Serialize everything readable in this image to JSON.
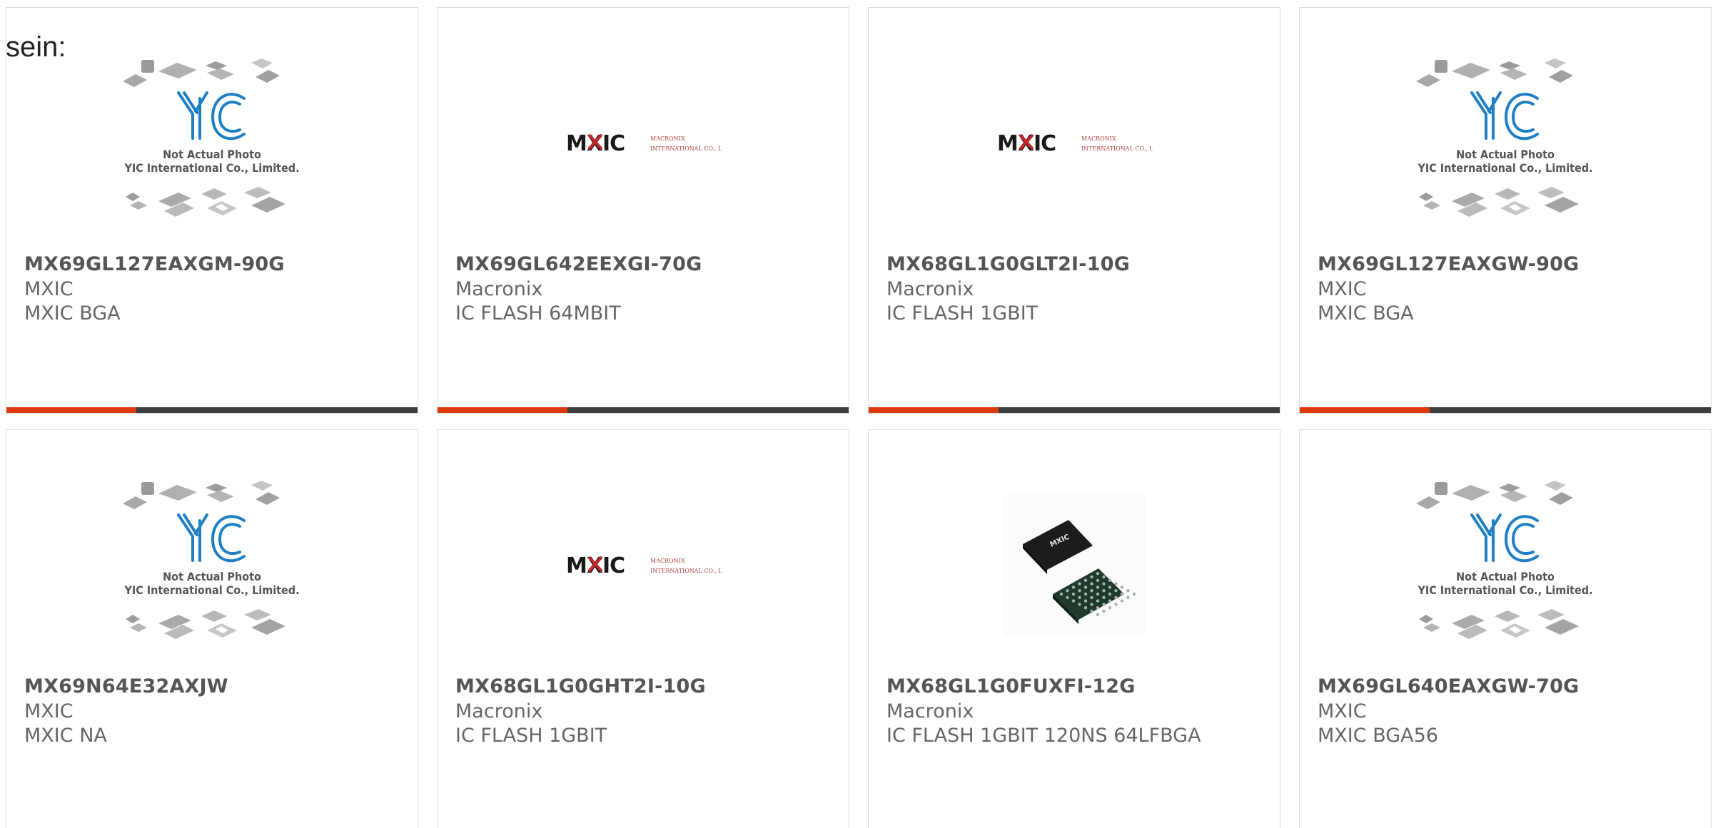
{
  "lead_text": "sein:",
  "products": [
    {
      "part": "MX69GL127EAXGM-90G",
      "manufacturer": "MXIC",
      "description": "MXIC BGA",
      "image": "yic-placeholder"
    },
    {
      "part": "MX69GL642EEXGI-70G",
      "manufacturer": "Macronix",
      "description": "IC FLASH 64MBIT",
      "image": "mxic-logo"
    },
    {
      "part": "MX68GL1G0GLT2I-10G",
      "manufacturer": "Macronix",
      "description": "IC FLASH 1GBIT",
      "image": "mxic-logo"
    },
    {
      "part": "MX69GL127EAXGW-90G",
      "manufacturer": "MXIC",
      "description": "MXIC BGA",
      "image": "yic-placeholder"
    },
    {
      "part": "MX69N64E32AXJW",
      "manufacturer": "MXIC",
      "description": "MXIC NA",
      "image": "yic-placeholder"
    },
    {
      "part": "MX68GL1G0GHT2I-10G",
      "manufacturer": "Macronix",
      "description": "IC FLASH 1GBIT",
      "image": "mxic-logo"
    },
    {
      "part": "MX68GL1G0FUXFI-12G",
      "manufacturer": "Macronix",
      "description": "IC FLASH 1GBIT 120NS 64LFBGA",
      "image": "chip-photo"
    },
    {
      "part": "MX69GL640EAXGW-70G",
      "manufacturer": "MXIC",
      "description": "MXIC BGA56",
      "image": "yic-placeholder"
    }
  ],
  "placeholder": {
    "logo_text": "YIC",
    "line1": "Not Actual Photo",
    "line2": "YIC International Co., Limited."
  },
  "mxic_logo": {
    "mark": "MXIC",
    "sub1": "MACRONIX",
    "sub2": "INTERNATIONAL CO., LTD."
  },
  "chip_label": "MXIC",
  "colors": {
    "accent_bar": "#dd3a0a",
    "dark_bar": "#3d3d3d",
    "yic_blue": "#1f7fc4",
    "mxic_red": "#c0272d"
  }
}
